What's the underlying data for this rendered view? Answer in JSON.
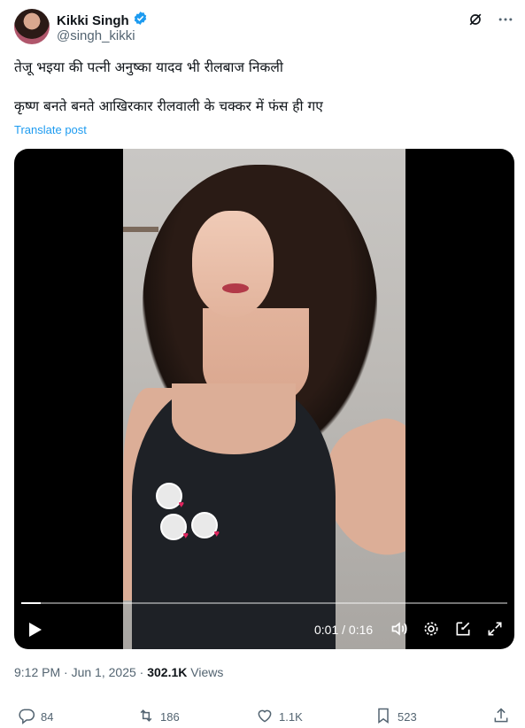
{
  "author": {
    "name": "Kikki Singh",
    "handle": "@singh_kikki"
  },
  "post": {
    "line1": "तेजू भइया की पत्नी अनुष्का यादव भी रीलबाज निकली",
    "line2": "कृष्ण बनते बनते आखिरकार रीलवाली के चक्कर में फंस ही गए",
    "translate_label": "Translate post"
  },
  "video": {
    "time_display": "0:01 / 0:16",
    "progress": 0.04
  },
  "meta": {
    "time": "9:12 PM",
    "sep": " · ",
    "date": "Jun 1, 2025",
    "sep2": " · ",
    "views_count": "302.1K",
    "views_label": " Views"
  },
  "actions": {
    "replies": "84",
    "reposts": "186",
    "likes": "1.1K",
    "bookmarks": "523"
  },
  "colors": {
    "link": "#1d9bf0",
    "verified": "#1d9bf0",
    "muted": "#536471"
  },
  "icons": [
    "verified-badge-icon",
    "grok-icon",
    "more-icon",
    "play-icon",
    "volume-icon",
    "settings-icon",
    "pip-icon",
    "fullscreen-icon",
    "reply-icon",
    "repost-icon",
    "like-icon",
    "bookmark-icon",
    "share-icon"
  ]
}
